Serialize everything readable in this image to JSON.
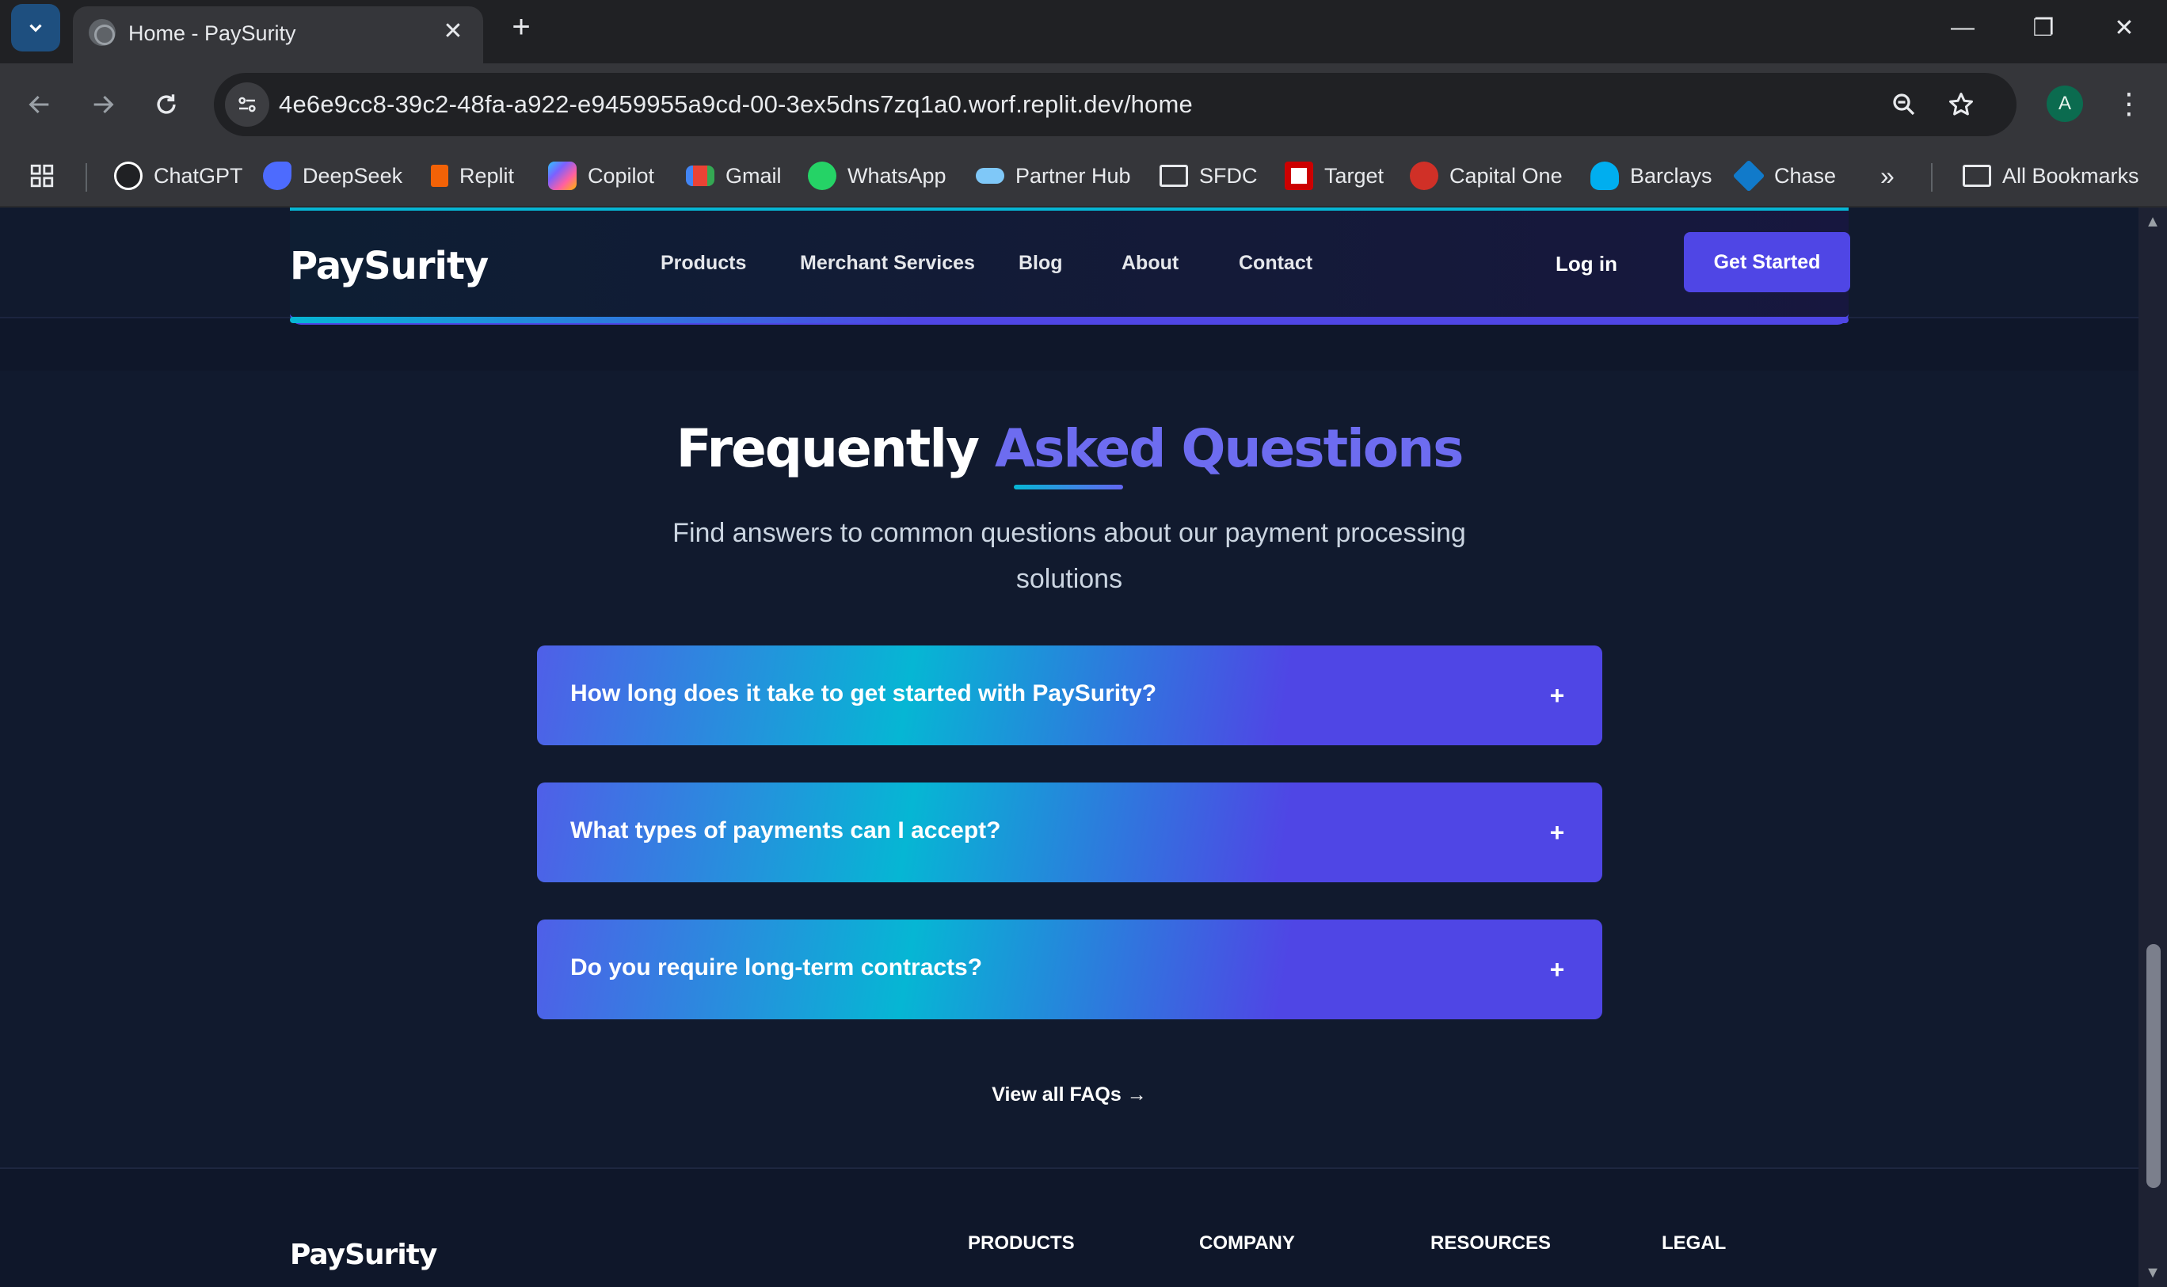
{
  "browser": {
    "tab_title": "Home - PaySurity",
    "url": "4e6e9cc8-39c2-48fa-a922-e9459955a9cd-00-3ex5dns7zq1a0.worf.replit.dev/home",
    "profile_initial": "A",
    "bookmarks": [
      {
        "label": "ChatGPT",
        "icon": "chatgpt-icon",
        "color": "#ffffff"
      },
      {
        "label": "DeepSeek",
        "icon": "deepseek-icon",
        "color": "#4d6bfe"
      },
      {
        "label": "Replit",
        "icon": "replit-icon",
        "color": "#f26207"
      },
      {
        "label": "Copilot",
        "icon": "copilot-icon",
        "color": "#7b61ff"
      },
      {
        "label": "Gmail",
        "icon": "gmail-icon",
        "color": "#ea4335"
      },
      {
        "label": "WhatsApp",
        "icon": "whatsapp-icon",
        "color": "#25d366"
      },
      {
        "label": "Partner Hub",
        "icon": "partner-hub-icon",
        "color": "#7fc8f8"
      },
      {
        "label": "SFDC",
        "icon": "folder-icon",
        "color": "#e8eaed"
      },
      {
        "label": "Target",
        "icon": "target-icon",
        "color": "#cc0000"
      },
      {
        "label": "Capital One",
        "icon": "capital-one-icon",
        "color": "#d03027"
      },
      {
        "label": "Barclays",
        "icon": "barclays-icon",
        "color": "#00aeef"
      },
      {
        "label": "Chase",
        "icon": "chase-icon",
        "color": "#117aca"
      }
    ],
    "more_bookmarks": "»",
    "all_bookmarks": "All Bookmarks"
  },
  "site": {
    "logo": "PaySurity",
    "nav": [
      "Products",
      "Merchant Services",
      "Blog",
      "About",
      "Contact"
    ],
    "login": "Log in",
    "cta": "Get Started"
  },
  "faq": {
    "title_white": "Frequently",
    "title_accent": "Asked Questions",
    "subtitle": "Find answers to common questions about our payment processing solutions",
    "items": [
      {
        "question": "How long does it take to get started with PaySurity?",
        "expand": "+"
      },
      {
        "question": "What types of payments can I accept?",
        "expand": "+"
      },
      {
        "question": "Do you require long-term contracts?",
        "expand": "+"
      }
    ],
    "view_all": "View all FAQs →"
  },
  "footer": {
    "logo": "PaySurity",
    "columns": [
      "PRODUCTS",
      "COMPANY",
      "RESOURCES",
      "LEGAL"
    ]
  },
  "colors": {
    "accent": "#4f46e5",
    "cyan": "#06b6d4",
    "background": "#0f172a"
  }
}
